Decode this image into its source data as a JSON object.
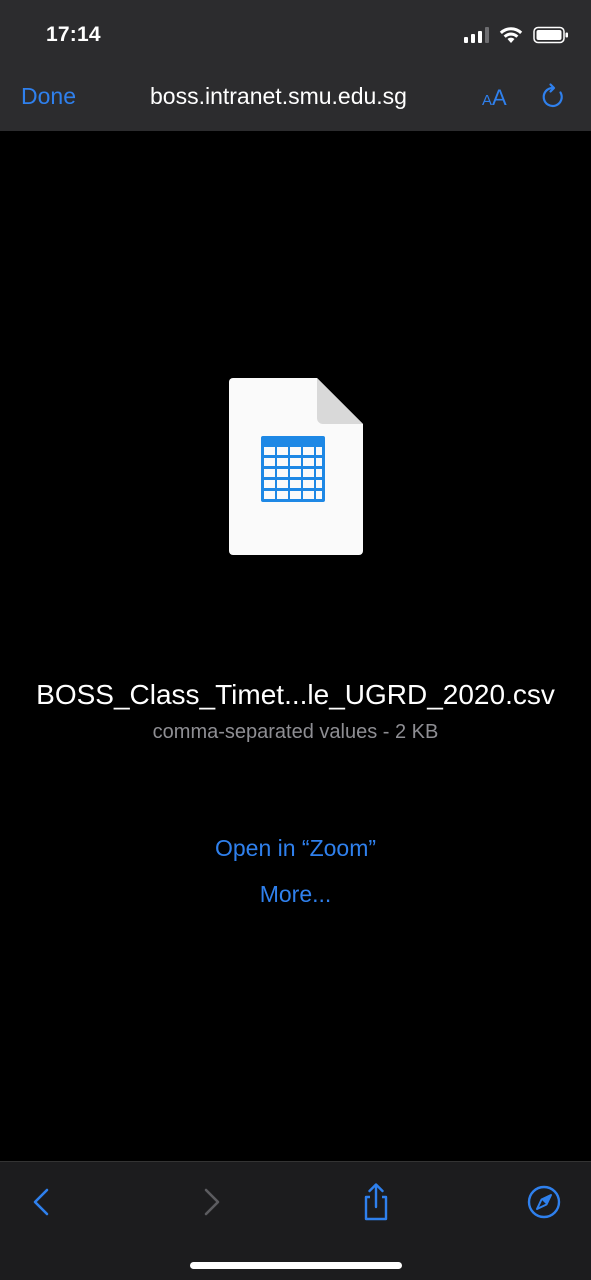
{
  "status_bar": {
    "time": "17:14"
  },
  "nav": {
    "done_label": "Done",
    "url": "boss.intranet.smu.edu.sg",
    "text_size_label_small": "A",
    "text_size_label_large": "A"
  },
  "document": {
    "icon": "spreadsheet-file-icon",
    "file_name": "BOSS_Class_Timet...le_UGRD_2020.csv",
    "file_meta": "comma-separated values - 2 KB",
    "open_in_label": "Open in “Zoom”",
    "more_label": "More..."
  },
  "toolbar": {
    "icons": [
      "back-icon",
      "forward-icon",
      "share-icon",
      "safari-compass-icon"
    ]
  },
  "colors": {
    "accent": "#2f80ed",
    "chrome_gray": "#2c2c2e",
    "background": "#000000",
    "secondary_text": "#8e8e93"
  }
}
